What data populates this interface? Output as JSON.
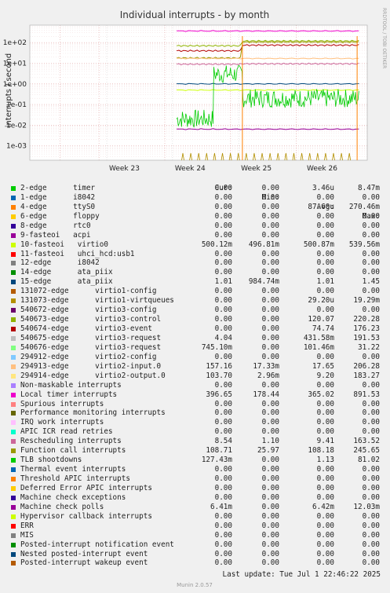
{
  "chart_data": {
    "type": "line",
    "title": "Individual interrupts - by month",
    "ylabel": "interrupts / second",
    "yscale": "log",
    "ylim": [
      0.0002,
      700
    ],
    "y_ticks": [
      "1e+02",
      "1e+01",
      "1e+00",
      "1e-01",
      "1e-02",
      "1e-03"
    ],
    "x_ticks": [
      "Week 23",
      "Week 24",
      "Week 25",
      "Week 26"
    ],
    "grid": true,
    "side_label": "RRDTOOL / TOBI OETIKER",
    "footer": "Munin 2.0.57",
    "columns": [
      "Cur:",
      "Min:",
      "Avg:",
      "Max:"
    ],
    "series": [
      {
        "name": "2-edge      timer",
        "color": "#00cc00",
        "cur": "0.00",
        "min": "0.00",
        "avg": "3.46u",
        "max": "8.47m"
      },
      {
        "name": "1-edge      i8042",
        "color": "#0066b3",
        "cur": "0.00",
        "min": "0.00",
        "avg": "0.00",
        "max": "0.00"
      },
      {
        "name": "4-edge      ttyS0",
        "color": "#ff8000",
        "cur": "0.00",
        "min": "0.00",
        "avg": "87.60u",
        "max": "270.46m"
      },
      {
        "name": "6-edge      floppy",
        "color": "#ffcc00",
        "cur": "0.00",
        "min": "0.00",
        "avg": "0.00",
        "max": "0.00"
      },
      {
        "name": "8-edge      rtc0",
        "color": "#330099",
        "cur": "0.00",
        "min": "0.00",
        "avg": "0.00",
        "max": "0.00"
      },
      {
        "name": "9-fasteoi   acpi",
        "color": "#990099",
        "cur": "0.00",
        "min": "0.00",
        "avg": "0.00",
        "max": "0.00"
      },
      {
        "name": "10-fasteoi   virtio0",
        "color": "#ccff00",
        "cur": "500.12m",
        "min": "496.81m",
        "avg": "500.87m",
        "max": "539.56m"
      },
      {
        "name": "11-fasteoi   uhci_hcd:usb1",
        "color": "#ff0000",
        "cur": "0.00",
        "min": "0.00",
        "avg": "0.00",
        "max": "0.00"
      },
      {
        "name": "12-edge      i8042",
        "color": "#808080",
        "cur": "0.00",
        "min": "0.00",
        "avg": "0.00",
        "max": "0.00"
      },
      {
        "name": "14-edge      ata_piix",
        "color": "#008f00",
        "cur": "0.00",
        "min": "0.00",
        "avg": "0.00",
        "max": "0.00"
      },
      {
        "name": "15-edge      ata_piix",
        "color": "#00487d",
        "cur": "1.01",
        "min": "984.74m",
        "avg": "1.01",
        "max": "1.45"
      },
      {
        "name": "131072-edge      virtio1-config",
        "color": "#b35a00",
        "cur": "0.00",
        "min": "0.00",
        "avg": "0.00",
        "max": "0.00"
      },
      {
        "name": "131073-edge      virtio1-virtqueues",
        "color": "#b38f00",
        "cur": "0.00",
        "min": "0.00",
        "avg": "29.20u",
        "max": "19.29m"
      },
      {
        "name": "540672-edge      virtio3-config",
        "color": "#6b006b",
        "cur": "0.00",
        "min": "0.00",
        "avg": "0.00",
        "max": "0.00"
      },
      {
        "name": "540673-edge      virtio3-control",
        "color": "#8fb300",
        "cur": "0.00",
        "min": "0.00",
        "avg": "120.07",
        "max": "220.28"
      },
      {
        "name": "540674-edge      virtio3-event",
        "color": "#b30000",
        "cur": "0.00",
        "min": "0.00",
        "avg": "74.74",
        "max": "176.23"
      },
      {
        "name": "540675-edge      virtio3-request",
        "color": "#bebebe",
        "cur": "4.04",
        "min": "0.00",
        "avg": "431.58m",
        "max": "191.53"
      },
      {
        "name": "540676-edge      virtio3-request",
        "color": "#80ff80",
        "cur": "745.10m",
        "min": "0.00",
        "avg": "101.46m",
        "max": "31.22"
      },
      {
        "name": "294912-edge      virtio2-config",
        "color": "#80c9ff",
        "cur": "0.00",
        "min": "0.00",
        "avg": "0.00",
        "max": "0.00"
      },
      {
        "name": "294913-edge      virtio2-input.0",
        "color": "#ffc080",
        "cur": "157.16",
        "min": "17.33m",
        "avg": "17.65",
        "max": "206.28"
      },
      {
        "name": "294914-edge      virtio2-output.0",
        "color": "#ffe680",
        "cur": "103.70",
        "min": "2.96m",
        "avg": "9.20",
        "max": "183.27"
      },
      {
        "name": "Non-maskable interrupts",
        "color": "#aa80ff",
        "cur": "0.00",
        "min": "0.00",
        "avg": "0.00",
        "max": "0.00"
      },
      {
        "name": "Local timer interrupts",
        "color": "#ee00cc",
        "cur": "396.65",
        "min": "178.44",
        "avg": "365.02",
        "max": "891.53"
      },
      {
        "name": "Spurious interrupts",
        "color": "#ff8080",
        "cur": "0.00",
        "min": "0.00",
        "avg": "0.00",
        "max": "0.00"
      },
      {
        "name": "Performance monitoring interrupts",
        "color": "#666600",
        "cur": "0.00",
        "min": "0.00",
        "avg": "0.00",
        "max": "0.00"
      },
      {
        "name": "IRQ work interrupts",
        "color": "#ffbfff",
        "cur": "0.00",
        "min": "0.00",
        "avg": "0.00",
        "max": "0.00"
      },
      {
        "name": "APIC ICR read retries",
        "color": "#00ffcc",
        "cur": "0.00",
        "min": "0.00",
        "avg": "0.00",
        "max": "0.00"
      },
      {
        "name": "Rescheduling interrupts",
        "color": "#cc6699",
        "cur": "8.54",
        "min": "1.10",
        "avg": "9.41",
        "max": "163.52"
      },
      {
        "name": "Function call interrupts",
        "color": "#999900",
        "cur": "108.71",
        "min": "25.97",
        "avg": "108.18",
        "max": "245.65"
      },
      {
        "name": "TLB shootdowns",
        "color": "#00cc00",
        "cur": "127.43m",
        "min": "0.00",
        "avg": "1.13",
        "max": "81.02"
      },
      {
        "name": "Thermal event interrupts",
        "color": "#0066b3",
        "cur": "0.00",
        "min": "0.00",
        "avg": "0.00",
        "max": "0.00"
      },
      {
        "name": "Threshold APIC interrupts",
        "color": "#ff8000",
        "cur": "0.00",
        "min": "0.00",
        "avg": "0.00",
        "max": "0.00"
      },
      {
        "name": "Deferred Error APIC interrupts",
        "color": "#ffcc00",
        "cur": "0.00",
        "min": "0.00",
        "avg": "0.00",
        "max": "0.00"
      },
      {
        "name": "Machine check exceptions",
        "color": "#330099",
        "cur": "0.00",
        "min": "0.00",
        "avg": "0.00",
        "max": "0.00"
      },
      {
        "name": "Machine check polls",
        "color": "#990099",
        "cur": "6.41m",
        "min": "0.00",
        "avg": "6.42m",
        "max": "12.03m"
      },
      {
        "name": "Hypervisor callback interrupts",
        "color": "#ccff00",
        "cur": "0.00",
        "min": "0.00",
        "avg": "0.00",
        "max": "0.00"
      },
      {
        "name": "ERR",
        "color": "#ff0000",
        "cur": "0.00",
        "min": "0.00",
        "avg": "0.00",
        "max": "0.00"
      },
      {
        "name": "MIS",
        "color": "#808080",
        "cur": "0.00",
        "min": "0.00",
        "avg": "0.00",
        "max": "0.00"
      },
      {
        "name": "Posted-interrupt notification event",
        "color": "#008f00",
        "cur": "0.00",
        "min": "0.00",
        "avg": "0.00",
        "max": "0.00"
      },
      {
        "name": "Nested posted-interrupt event",
        "color": "#00487d",
        "cur": "0.00",
        "min": "0.00",
        "avg": "0.00",
        "max": "0.00"
      },
      {
        "name": "Posted-interrupt wakeup event",
        "color": "#b35a00",
        "cur": "0.00",
        "min": "0.00",
        "avg": "0.00",
        "max": "0.00"
      }
    ],
    "last_update": "Last update: Tue Jul  1 22:46:22 2025"
  }
}
